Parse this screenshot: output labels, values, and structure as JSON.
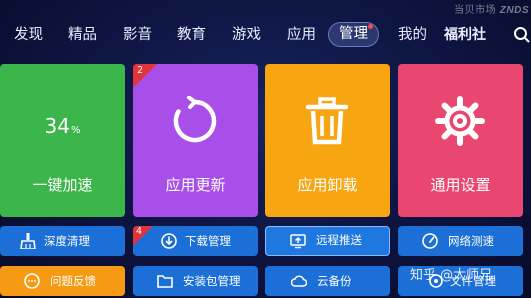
{
  "watermark_top": {
    "text": "当贝市场",
    "brand": "ZNDS"
  },
  "nav": {
    "items": [
      "发现",
      "精品",
      "影音",
      "教育",
      "游戏",
      "应用",
      "管理",
      "我的",
      "福利社"
    ],
    "active": "管理"
  },
  "tiles": {
    "speedup": {
      "value": "34",
      "unit": "%",
      "label": "一键加速",
      "color": "#3cb64a"
    },
    "update": {
      "label": "应用更新",
      "badge": "2",
      "color": "#a74fe8"
    },
    "uninstall": {
      "label": "应用卸载",
      "color": "#f8a512"
    },
    "settings": {
      "label": "通用设置",
      "color": "#e94770"
    }
  },
  "buttons_row1": {
    "deep_clean": "深度清理",
    "download_mgr": "下载管理",
    "download_badge": "4",
    "remote_push": "远程推送",
    "net_speed": "网络测速"
  },
  "buttons_row2": {
    "feedback": "问题反馈",
    "package_mgr": "安装包管理",
    "cloud_backup": "云备份",
    "file_mgr": "文件管理"
  },
  "watermark_bottom": "知乎 @大师兄"
}
